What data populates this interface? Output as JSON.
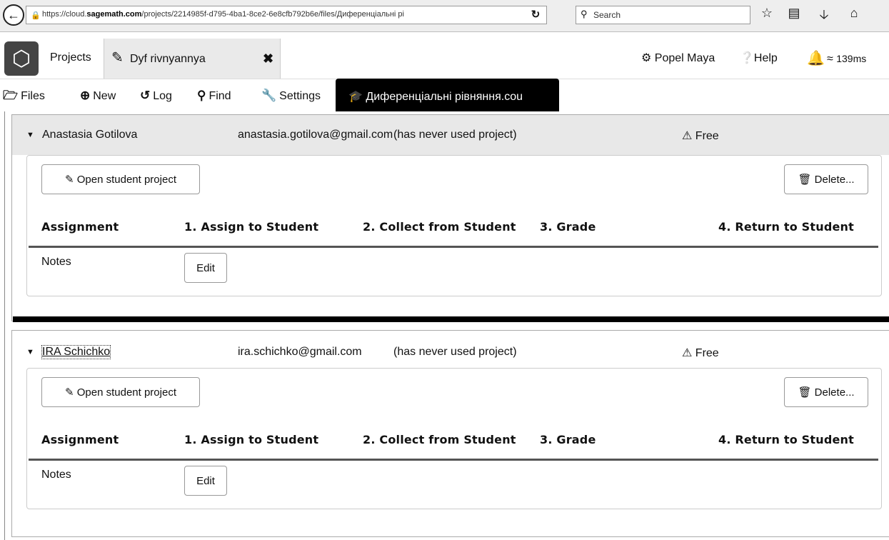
{
  "browser": {
    "url_prefix": "https://cloud.",
    "url_host": "sagemath.com",
    "url_path": "/projects/2214985f-d795-4ba1-8ce2-6e8cfb792b6e/files/Диференціальні рі",
    "search_placeholder": "Search"
  },
  "topbar": {
    "projects_label": "Projects",
    "project_tab_label": "Dyf rivnyannya",
    "user_label": "Popel Maya",
    "help_label": "Help",
    "ping_label": "139ms"
  },
  "toolbar": {
    "files_label": "Files",
    "new_label": "New",
    "log_label": "Log",
    "find_label": "Find",
    "settings_label": "Settings",
    "file_tab_label": "Диференціальні рівняння.cou"
  },
  "students": [
    {
      "name": "Anastasia Gotilova",
      "email": "anastasia.gotilova@gmail.com",
      "status": "(has never used project)",
      "plan": "Free",
      "open_label": "Open student project",
      "delete_label": "Delete...",
      "headers": [
        "Assignment",
        "1. Assign to Student",
        "2. Collect from Student",
        "3. Grade",
        "4. Return to Student"
      ],
      "notes_label": "Notes",
      "edit_label": "Edit"
    },
    {
      "name": "IRA Schichko",
      "email": "ira.schichko@gmail.com",
      "status": "(has never used project)",
      "plan": "Free",
      "open_label": "Open student project",
      "delete_label": "Delete...",
      "headers": [
        "Assignment",
        "1. Assign to Student",
        "2. Collect from Student",
        "3. Grade",
        "4. Return to Student"
      ],
      "notes_label": "Notes",
      "edit_label": "Edit"
    }
  ],
  "icons": {
    "back": "back-arrow-icon",
    "lock": "lock-icon",
    "reload": "reload-icon",
    "search": "search-icon",
    "bookmark": "star-icon",
    "reader": "reader-icon",
    "download": "download-icon",
    "home": "home-icon",
    "gear": "gear-icon",
    "help": "question-circle-icon",
    "bell": "bell-icon",
    "wifi": "wifi-icon",
    "warning": "warning-icon",
    "trash": "trash-icon",
    "edit": "edit-icon"
  }
}
